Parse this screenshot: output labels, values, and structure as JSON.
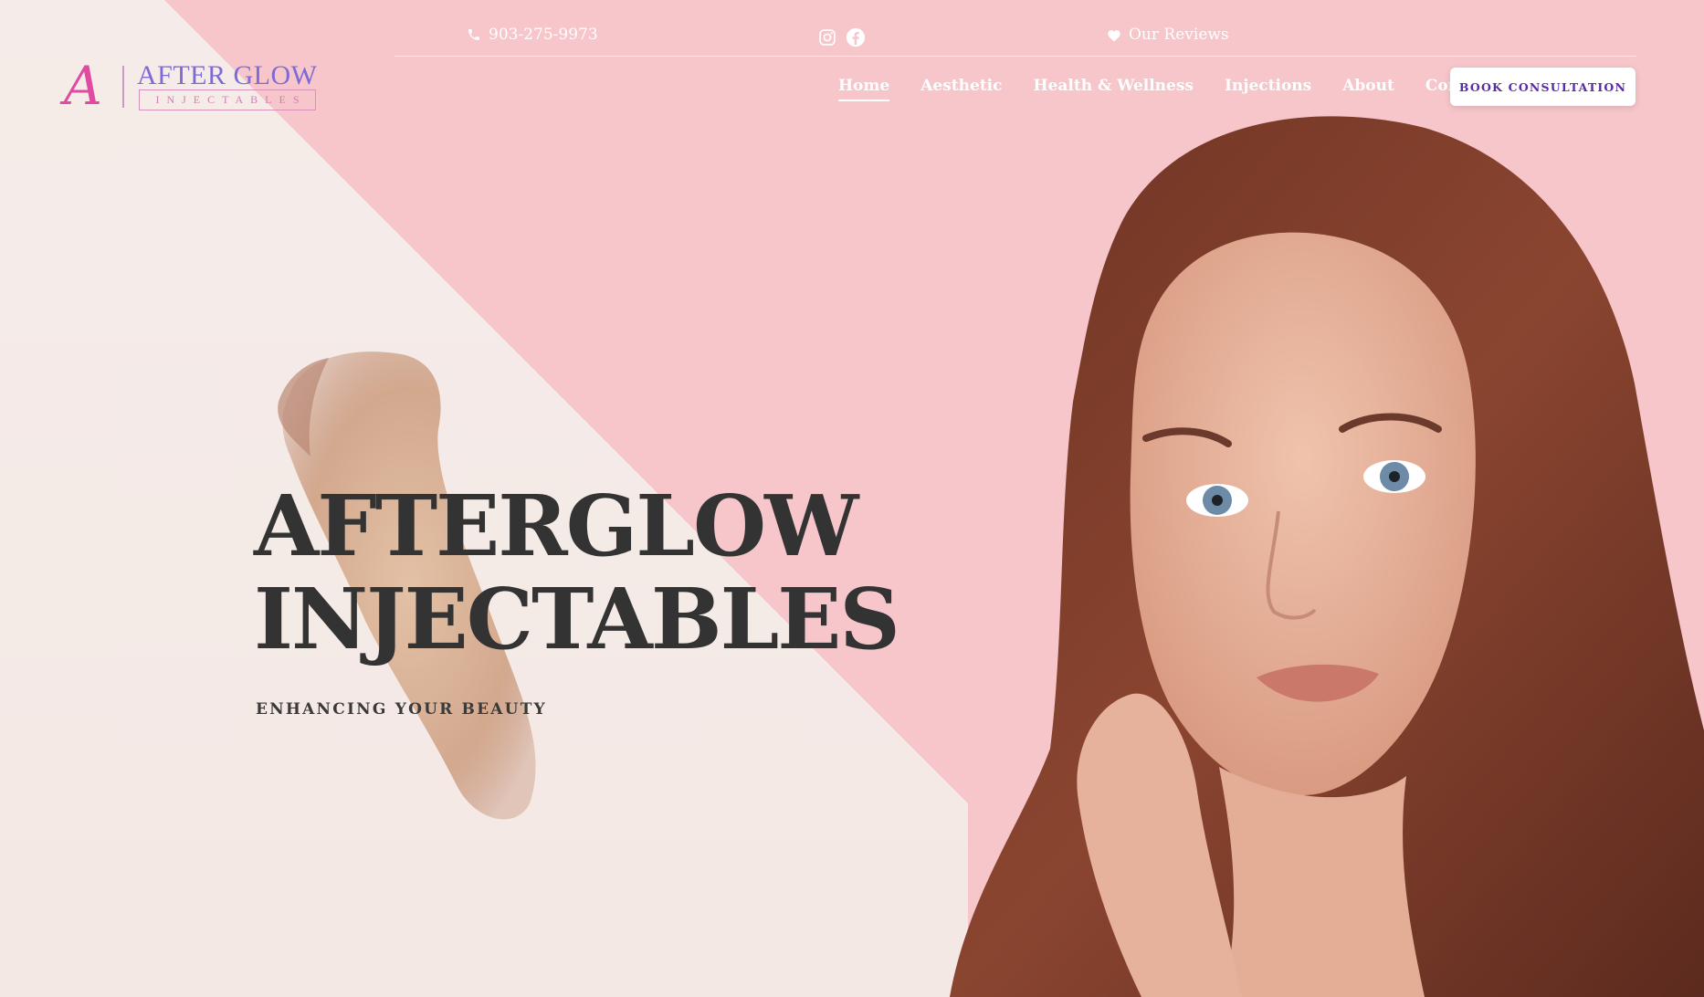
{
  "colors": {
    "pink_bg": "#f6c6cb",
    "cream_bg": "#f6e9e6",
    "headline": "#333333",
    "cta_text": "#5b2aa8",
    "logo_script": "#e04aa2",
    "logo_title": "#7c6bd6"
  },
  "topbar": {
    "phone_icon": "phone-icon",
    "phone": "903-275-9973",
    "social_icons": [
      "instagram-icon",
      "facebook-icon"
    ],
    "reviews_icon": "heart-icon",
    "reviews": "Our Reviews"
  },
  "logo": {
    "script": "A",
    "title": "AFTER GLOW",
    "subtitle": "INJECTABLES"
  },
  "nav": {
    "items": [
      "Home",
      "Aesthetic",
      "Health & Wellness",
      "Injections",
      "About",
      "Contact"
    ],
    "active": "Home"
  },
  "cta": {
    "label": "BOOK CONSULTATION"
  },
  "hero": {
    "headline_line1": "AFTERGLOW",
    "headline_line2": "INJECTABLES",
    "subheadline": "ENHANCING YOUR BEAUTY"
  }
}
